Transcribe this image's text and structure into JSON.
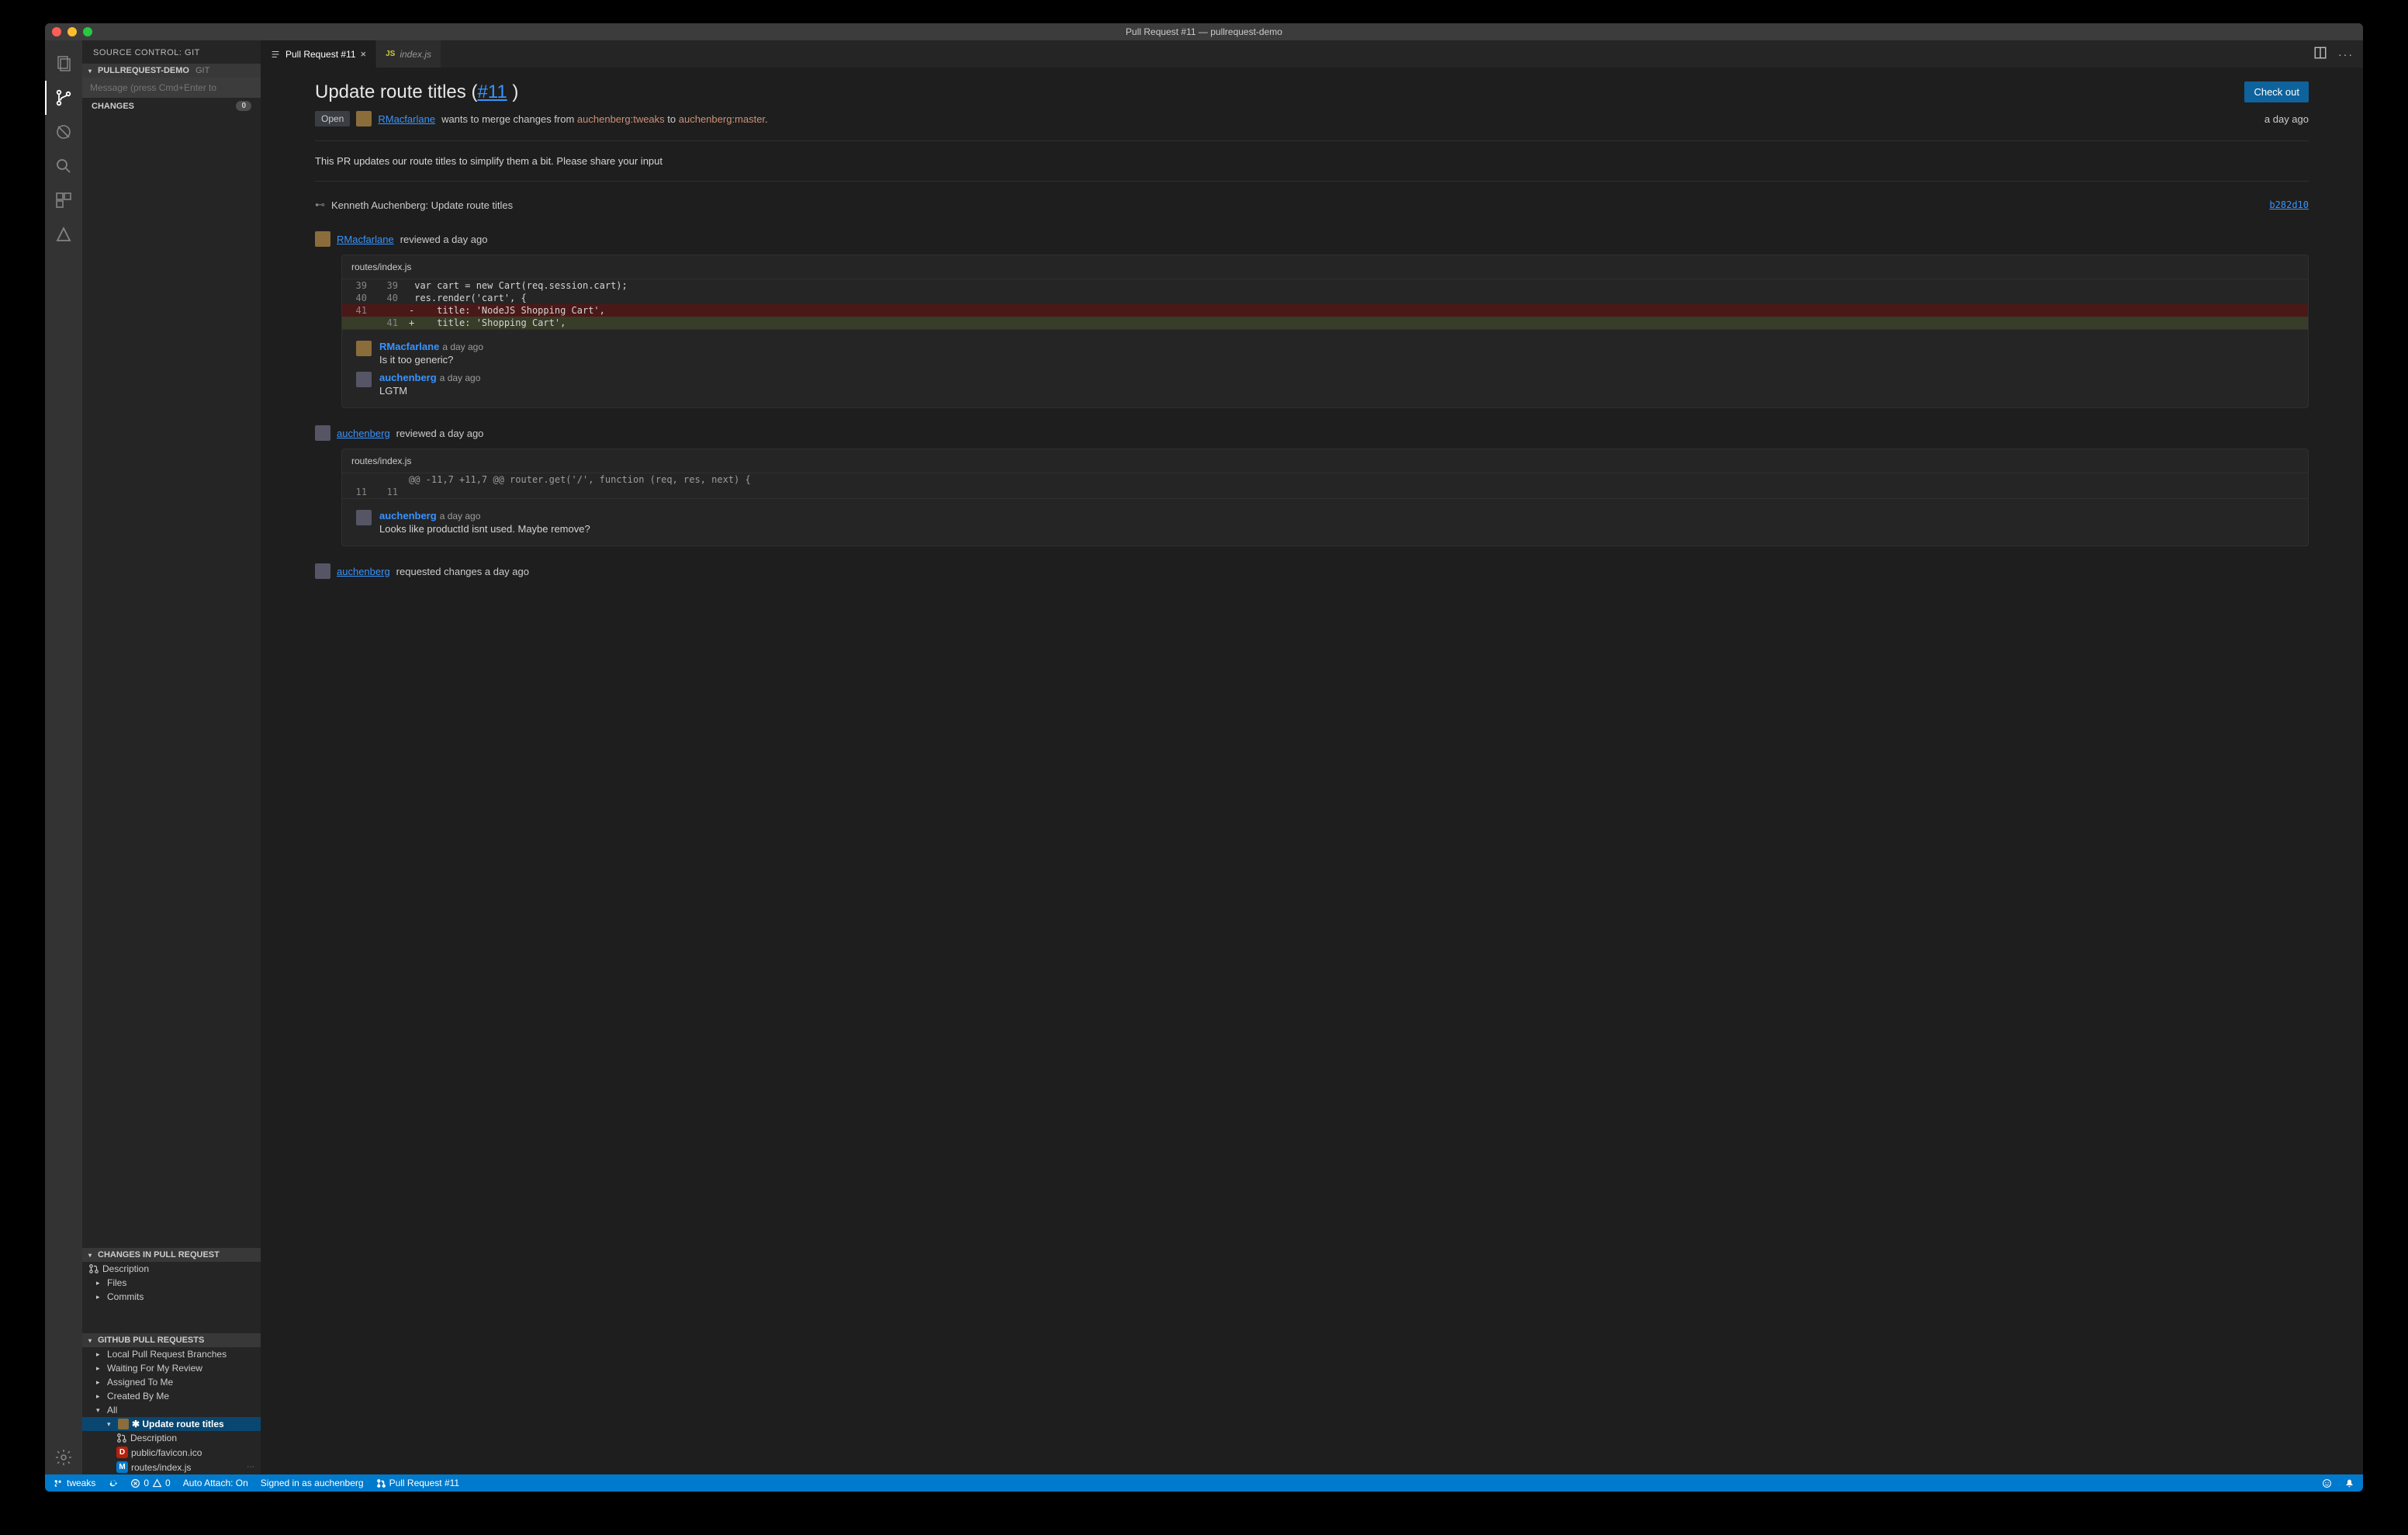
{
  "window": {
    "title": "Pull Request #11 — pullrequest-demo"
  },
  "sidebar": {
    "title": "SOURCE CONTROL: GIT",
    "repo_header": "PULLREQUEST-DEMO",
    "repo_hint": "GIT",
    "message_placeholder": "Message (press Cmd+Enter to",
    "changes_label": "CHANGES",
    "changes_count": "0",
    "pr_changes_header": "CHANGES IN PULL REQUEST",
    "pr_changes": {
      "description": "Description",
      "files": "Files",
      "commits": "Commits"
    },
    "ghpr_header": "GITHUB PULL REQUESTS",
    "ghpr": {
      "local": "Local Pull Request Branches",
      "waiting": "Waiting For My Review",
      "assigned": "Assigned To Me",
      "created": "Created By Me",
      "all": "All",
      "selected": "✱ Update route titles",
      "desc": "Description",
      "file1": "public/favicon.ico",
      "file2": "routes/index.js"
    }
  },
  "tabs": {
    "active_label": "Pull Request #11",
    "inactive_label": "index.js"
  },
  "pr": {
    "title_prefix": "Update route titles (",
    "title_num": "#11",
    "title_suffix": " )",
    "checkout": "Check out",
    "state": "Open",
    "author": "RMacfarlane",
    "meta_mid": " wants to merge changes from ",
    "branch_from": "auchenberg:tweaks",
    "meta_to": " to ",
    "branch_to": "auchenberg:master",
    "meta_end": ".",
    "time": "a day ago",
    "description": "This PR updates our route titles to simplify them a bit. Please share your input",
    "commit": {
      "author": "Kenneth Auchenberg: Update route titles",
      "sha": "b282d10"
    },
    "reviews": [
      {
        "who": "RMacfarlane",
        "status": "reviewed a day ago",
        "file": "routes/index.js",
        "diff": [
          {
            "l": "39",
            "r": "39",
            "t": "ctx",
            "code": " var cart = new Cart(req.session.cart);"
          },
          {
            "l": "40",
            "r": "40",
            "t": "ctx",
            "code": " res.render('cart', {"
          },
          {
            "l": "41",
            "r": "",
            "t": "del",
            "code": "-    title: 'NodeJS Shopping Cart',"
          },
          {
            "l": "",
            "r": "41",
            "t": "add",
            "code": "+    title: 'Shopping Cart',"
          }
        ],
        "comments": [
          {
            "who": "RMacfarlane",
            "when": "a day ago",
            "msg": "Is it too generic?"
          },
          {
            "who": "auchenberg",
            "when": "a day ago",
            "msg": "LGTM"
          }
        ]
      },
      {
        "who": "auchenberg",
        "status": "reviewed a day ago",
        "file": "routes/index.js",
        "hunk": "@@ -11,7 +11,7 @@ router.get('/', function (req, res, next) {",
        "hunk_l": "11",
        "hunk_r": "11",
        "comments": [
          {
            "who": "auchenberg",
            "when": "a day ago",
            "msg": "Looks like productId isnt used. Maybe remove?"
          }
        ]
      }
    ],
    "final": {
      "who": "auchenberg",
      "status": "requested changes a day ago"
    }
  },
  "statusbar": {
    "branch": "tweaks",
    "errors": "0",
    "warnings": "0",
    "autoattach": "Auto Attach: On",
    "signedin": "Signed in as auchenberg",
    "pr": "Pull Request #11"
  }
}
